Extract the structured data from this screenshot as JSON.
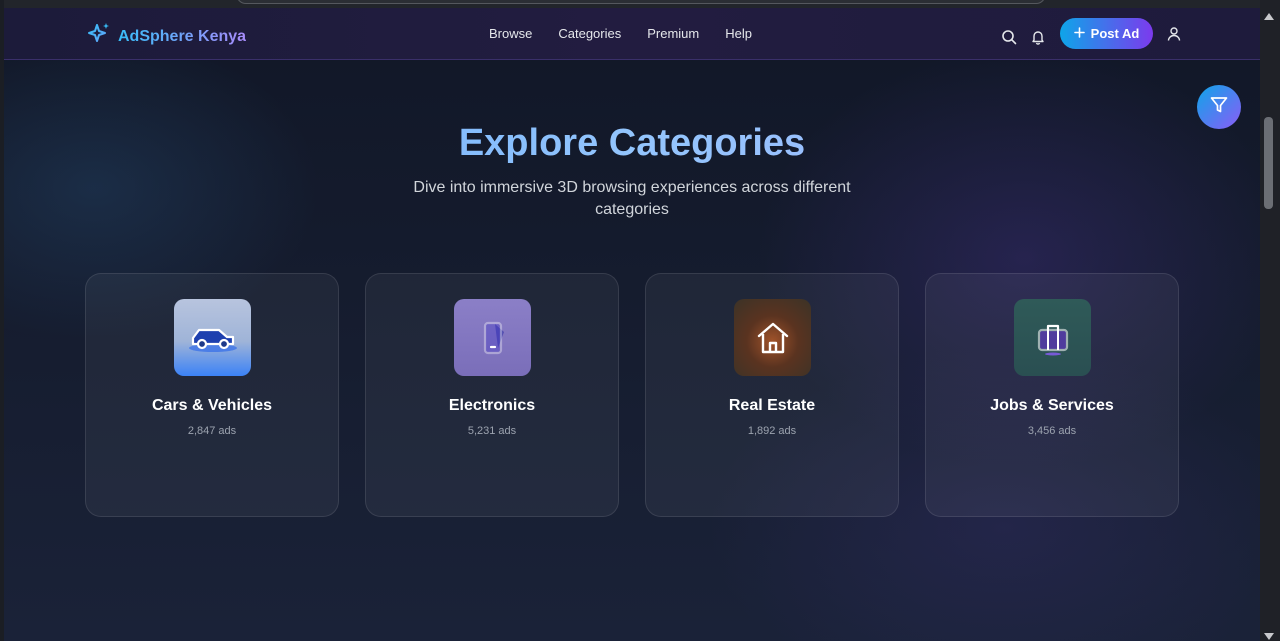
{
  "navbar": {
    "brand": "AdSphere Kenya",
    "links": [
      "Browse",
      "Categories",
      "Premium",
      "Help"
    ],
    "post_ad_label": "Post Ad",
    "icons": [
      "search-icon",
      "bell-icon",
      "plus-icon",
      "user-icon"
    ]
  },
  "hero": {
    "title": "Explore Categories",
    "subtitle": "Dive into immersive 3D browsing experiences across different categories"
  },
  "categories": [
    {
      "name": "Cars & Vehicles",
      "count": "2,847 ads",
      "icon": "car-icon"
    },
    {
      "name": "Electronics",
      "count": "5,231 ads",
      "icon": "smartphone-icon"
    },
    {
      "name": "Real Estate",
      "count": "1,892 ads",
      "icon": "house-icon"
    },
    {
      "name": "Jobs & Services",
      "count": "3,456 ads",
      "icon": "briefcase-icon"
    }
  ],
  "colors": {
    "accent_start": "#0ea5e9",
    "accent_end": "#7c3aed",
    "background": "#111727"
  }
}
